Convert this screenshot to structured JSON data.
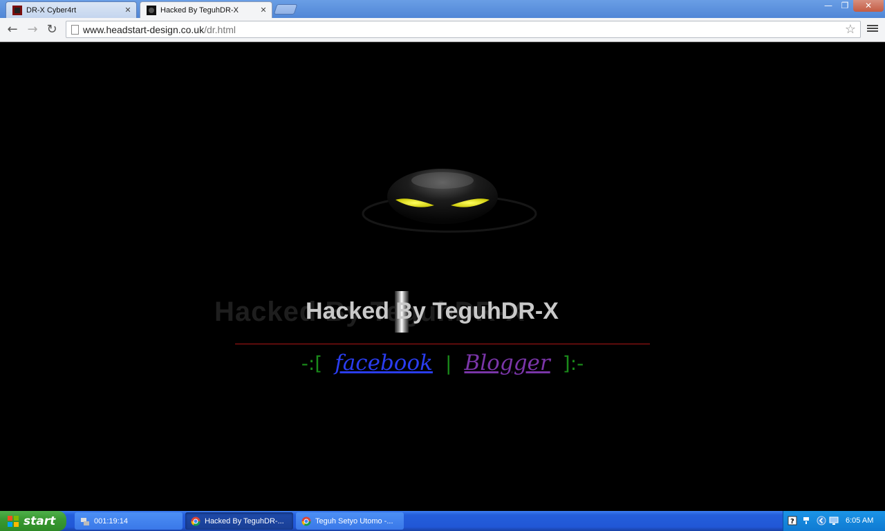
{
  "browser": {
    "tabs": [
      {
        "title": "DR-X Cyber4rt",
        "close": "✕"
      },
      {
        "title": "Hacked By TeguhDR-X",
        "close": "✕"
      }
    ],
    "window_controls": {
      "minimize": "—",
      "maximize": "❐",
      "close": "✕"
    },
    "nav": {
      "back": "←",
      "forward": "→",
      "reload": "↻"
    },
    "url_host": "www.headstart-design.co.uk",
    "url_path": "/dr.html",
    "star": "☆"
  },
  "page": {
    "ghost_text": "Hacked By TeguhDR-X",
    "headline": "Hacked By TeguhDR-X",
    "links": {
      "open": "-:[",
      "facebook": "facebook",
      "separator": "|",
      "blogger": "Blogger",
      "close": "]:-"
    },
    "colors": {
      "rule": "#b01515",
      "bracket": "#1a8a1a",
      "facebook": "#2a3df0",
      "blogger": "#7a35a8",
      "eyes": "#f2f20a"
    }
  },
  "taskbar": {
    "start_label": "start",
    "tasks": [
      {
        "label": "001:19:14",
        "icon": "network-icon"
      },
      {
        "label": "Hacked By TeguhDR-...",
        "icon": "chrome-icon"
      },
      {
        "label": "Teguh Setyo Utomo -...",
        "icon": "chrome-icon"
      }
    ],
    "clock": "6:05 AM"
  }
}
